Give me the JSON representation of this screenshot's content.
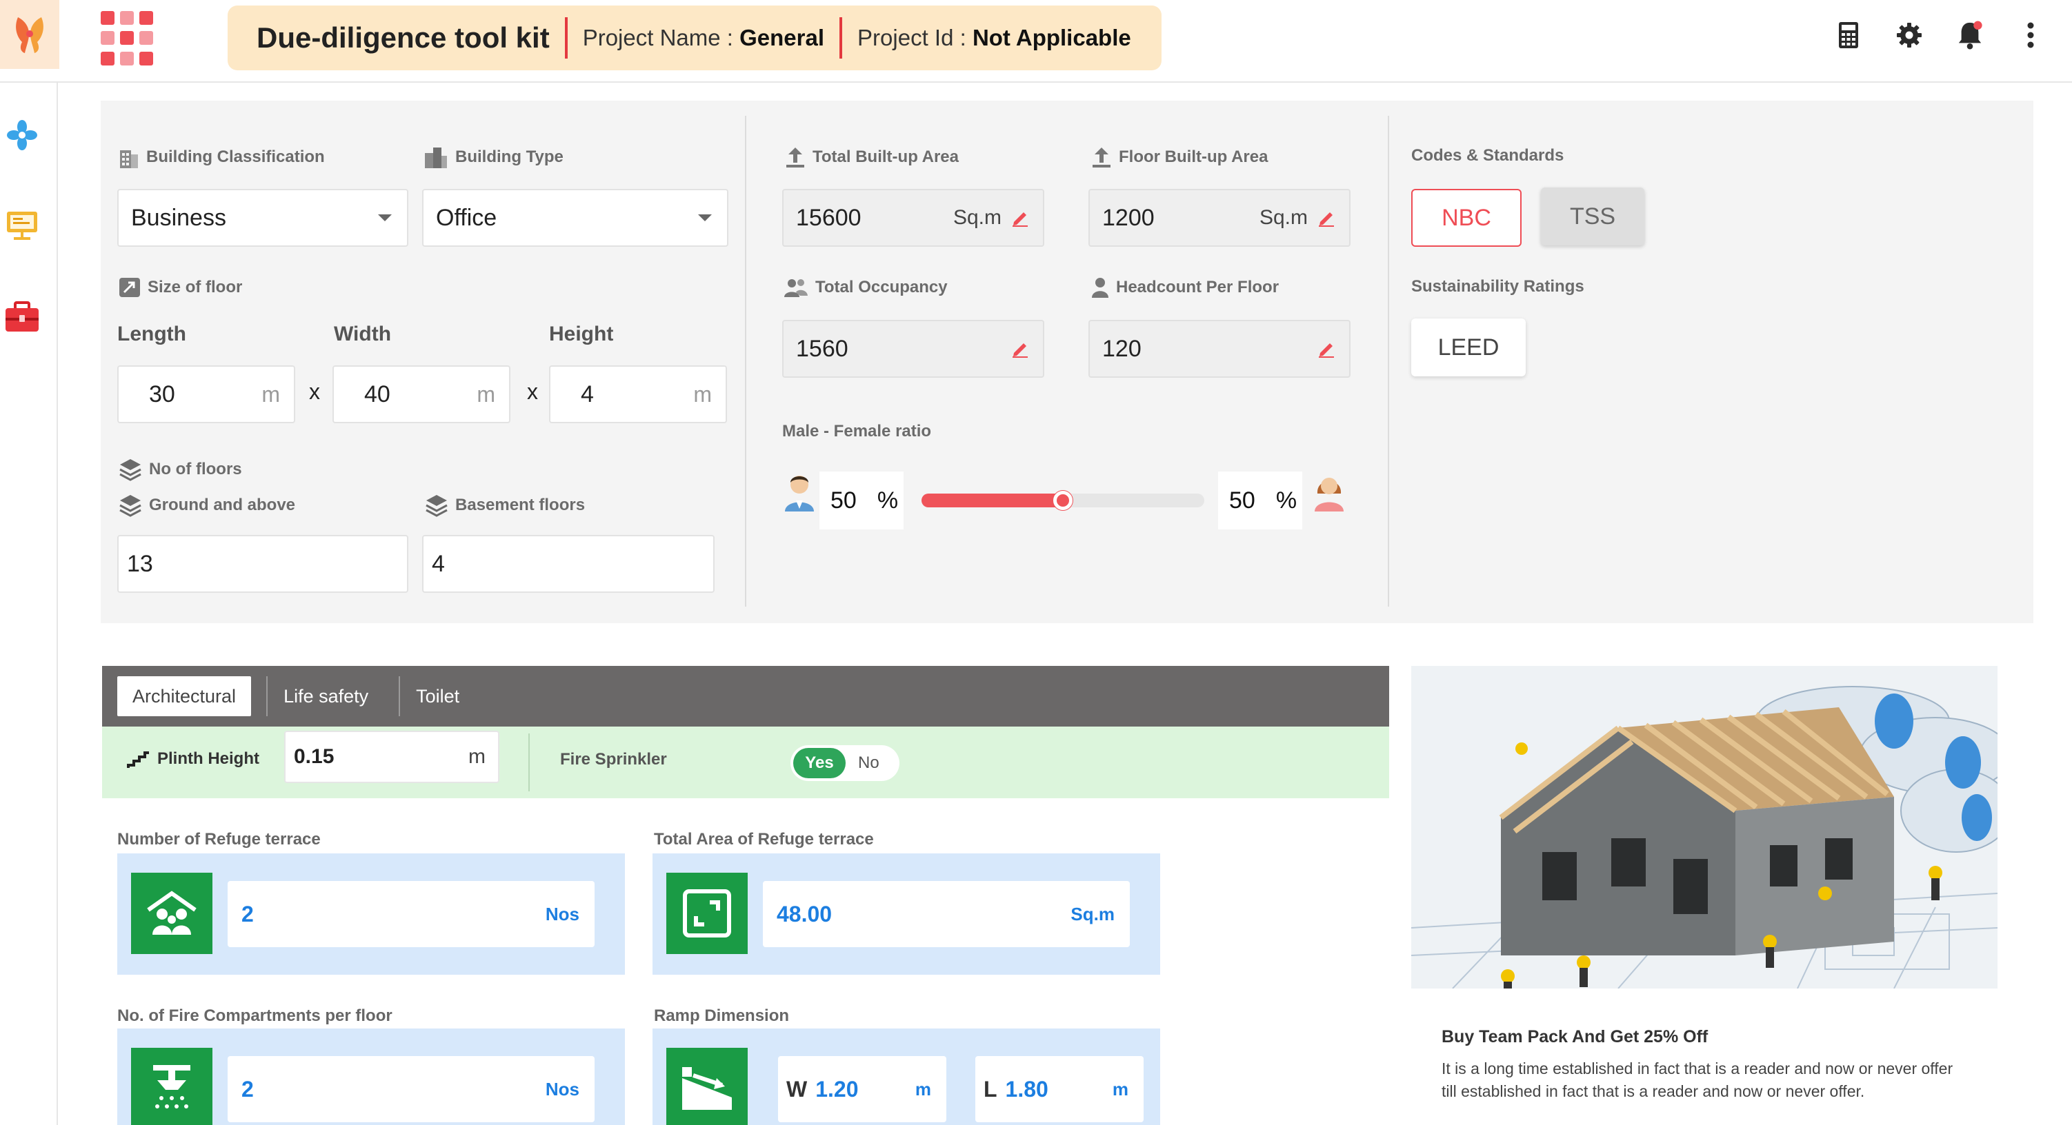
{
  "header": {
    "app_title": "Due-diligence tool kit",
    "project_name_label": "Project Name :",
    "project_name_value": "General",
    "project_id_label": "Project Id :",
    "project_id_value": "Not Applicable",
    "icons": [
      "calculator-icon",
      "settings-icon",
      "notification-bell-icon",
      "more-options-icon"
    ]
  },
  "sidebar": {
    "icons": [
      "fan-icon",
      "presentation-board-icon",
      "toolbox-icon"
    ]
  },
  "building": {
    "classification_label": "Building Classification",
    "classification_value": "Business",
    "type_label": "Building Type",
    "type_value": "Office",
    "size_label": "Size of floor",
    "length_label": "Length",
    "length_value": "30",
    "width_label": "Width",
    "width_value": "40",
    "height_label": "Height",
    "height_value": "4",
    "unit_m": "m",
    "times": "x",
    "floors_label": "No of floors",
    "ground_label": "Ground and above",
    "ground_value": "13",
    "basement_label": "Basement floors",
    "basement_value": "4"
  },
  "area": {
    "total_builtup_label": "Total Built-up Area",
    "total_builtup_value": "15600",
    "floor_builtup_label": "Floor Built-up Area",
    "floor_builtup_value": "1200",
    "unit_sqm": "Sq.m",
    "total_occupancy_label": "Total Occupancy",
    "total_occupancy_value": "1560",
    "headcount_label": "Headcount Per Floor",
    "headcount_value": "120",
    "ratio_label": "Male - Female ratio",
    "male_pct": "50",
    "female_pct": "50",
    "pct_symbol": "%",
    "male_ratio_fraction": 0.5
  },
  "standards": {
    "codes_label": "Codes & Standards",
    "nbc": "NBC",
    "tss": "TSS",
    "sustainability_label": "Sustainability Ratings",
    "leed": "LEED",
    "accent": "#ef4d55"
  },
  "tabs": {
    "items": [
      "Architectural",
      "Life safety",
      "Toilet"
    ],
    "active": "Architectural"
  },
  "arch": {
    "plinth_label": "Plinth Height",
    "plinth_value": "0.15",
    "plinth_unit": "m",
    "sprinkler_label": "Fire Sprinkler",
    "yes": "Yes",
    "no": "No",
    "refuge_count_label": "Number of Refuge terrace",
    "refuge_count_value": "2",
    "refuge_count_unit": "Nos",
    "refuge_area_label": "Total Area of Refuge terrace",
    "refuge_area_value": "48.00",
    "refuge_area_unit": "Sq.m",
    "compartments_label": "No. of Fire Compartments per floor",
    "compartments_value": "2",
    "compartments_unit": "Nos",
    "ramp_label": "Ramp Dimension",
    "ramp_w_prefix": "W",
    "ramp_w_value": "1.20",
    "ramp_l_prefix": "L",
    "ramp_l_value": "1.80",
    "ramp_unit": "m"
  },
  "promo": {
    "title": "Buy Team Pack And Get 25% Off",
    "text": "It is a long time established in fact that is a reader and now or never offer till established in fact that is a reader and now or never offer."
  }
}
